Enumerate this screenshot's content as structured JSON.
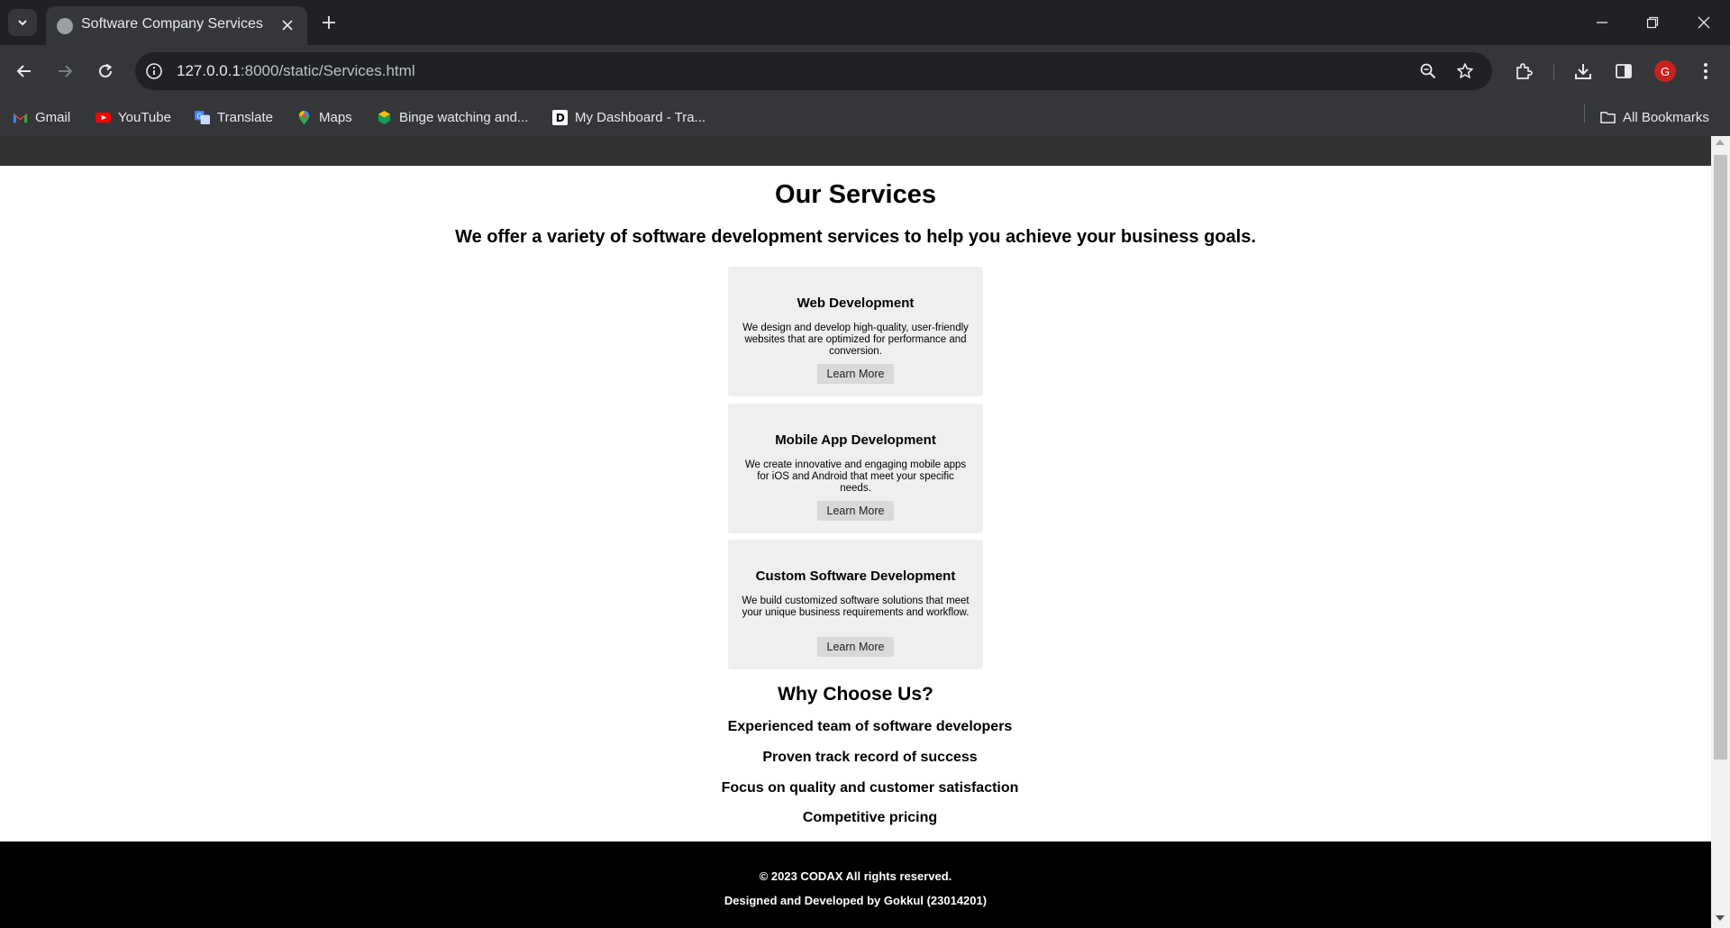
{
  "browser": {
    "tab_title": "Software Company Services",
    "url_host": "127.0.0.1",
    "url_path": ":8000/static/Services.html",
    "avatar_letter": "G",
    "accent": "#c5221f"
  },
  "bookmarks": {
    "items": [
      {
        "label": "Gmail",
        "icon": "gmail-icon"
      },
      {
        "label": "YouTube",
        "icon": "youtube-icon"
      },
      {
        "label": "Translate",
        "icon": "translate-icon"
      },
      {
        "label": "Maps",
        "icon": "maps-icon"
      },
      {
        "label": "Binge watching and...",
        "icon": "binge-icon"
      },
      {
        "label": "My Dashboard - Tra...",
        "icon": "dashboard-icon"
      }
    ],
    "all_bookmarks": "All Bookmarks"
  },
  "page": {
    "title": "Our Services",
    "lead": "We offer a variety of software development services to help you achieve your business goals.",
    "services": [
      {
        "title": "Web Development",
        "desc": "We design and develop high-quality, user-friendly websites that are optimized for performance and conversion.",
        "button": "Learn More"
      },
      {
        "title": "Mobile App Development",
        "desc": "We create innovative and engaging mobile apps for iOS and Android that meet your specific needs.",
        "button": "Learn More"
      },
      {
        "title": "Custom Software Development",
        "desc": "We build customized software solutions that meet your unique business requirements and workflow.",
        "button": "Learn More"
      }
    ],
    "why_title": "Why Choose Us?",
    "reasons": [
      "Experienced team of software developers",
      "Proven track record of success",
      "Focus on quality and customer satisfaction",
      "Competitive pricing"
    ]
  },
  "footer": {
    "copyright": "© 2023  CODAX  All rights reserved.",
    "credit": "Designed and Developed by Gokkul (23014201)"
  }
}
